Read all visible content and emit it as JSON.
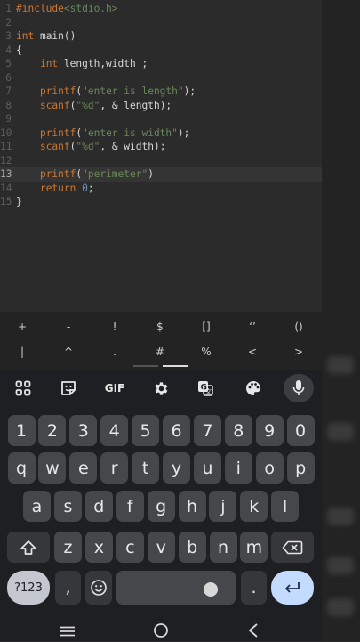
{
  "editor": {
    "lines": [
      {
        "n": "1",
        "html": "<span class='kw'>#include</span><span class='str'>&lt;stdio.h&gt;</span>"
      },
      {
        "n": "2",
        "html": ""
      },
      {
        "n": "3",
        "html": "<span class='kw'>int</span> main()"
      },
      {
        "n": "4",
        "html": "{"
      },
      {
        "n": "5",
        "html": "    <span class='kw'>int</span> length,width ;"
      },
      {
        "n": "6",
        "html": ""
      },
      {
        "n": "7",
        "html": "    <span class='kw'>printf</span>(<span class='str'>\"enter is length\"</span>);"
      },
      {
        "n": "8",
        "html": "    <span class='kw'>scanf</span>(<span class='str'>\"%d\"</span>, &amp; length);"
      },
      {
        "n": "9",
        "html": ""
      },
      {
        "n": "10",
        "html": "    <span class='kw'>printf</span>(<span class='str'>\"enter is width\"</span>);"
      },
      {
        "n": "11",
        "html": "    <span class='kw'>scanf</span>(<span class='str'>\"%d\"</span>, &amp; width);"
      },
      {
        "n": "12",
        "html": ""
      },
      {
        "n": "13",
        "html": "    <span class='kw'>printf</span>(<span class='str'>\"perimeter\"</span>)"
      },
      {
        "n": "14",
        "html": "    <span class='kw'>return</span> <span class='num'>0</span>;"
      },
      {
        "n": "15",
        "html": "}"
      }
    ],
    "current_line": "13"
  },
  "symbol_bar": {
    "row1": [
      "+",
      "-",
      "!",
      "$",
      "[]",
      "‘’",
      "()"
    ],
    "row2": [
      "|",
      "^",
      ".",
      "#",
      "%",
      "<",
      ">"
    ]
  },
  "suggestion_strip": {
    "gif_label": "GIF",
    "icons": [
      "apps-grid-icon",
      "sticker-icon",
      "gif-icon",
      "settings-gear-icon",
      "translate-icon",
      "palette-icon",
      "microphone-icon"
    ]
  },
  "keyboard": {
    "row_numbers": [
      "1",
      "2",
      "3",
      "4",
      "5",
      "6",
      "7",
      "8",
      "9",
      "0"
    ],
    "row_q": [
      "q",
      "w",
      "e",
      "r",
      "t",
      "y",
      "u",
      "i",
      "o",
      "p"
    ],
    "row_a": [
      "a",
      "s",
      "d",
      "f",
      "g",
      "h",
      "j",
      "k",
      "l"
    ],
    "row_z": [
      "z",
      "x",
      "c",
      "v",
      "b",
      "n",
      "m"
    ],
    "mode_label": "?123",
    "comma": ",",
    "period": ".",
    "space_label": ""
  },
  "colors": {
    "editor_bg": "#2b2b2b",
    "keyword": "#cc7832",
    "string": "#6a8759",
    "key_bg": "#46474b",
    "enter_bg": "#c3dbff"
  }
}
